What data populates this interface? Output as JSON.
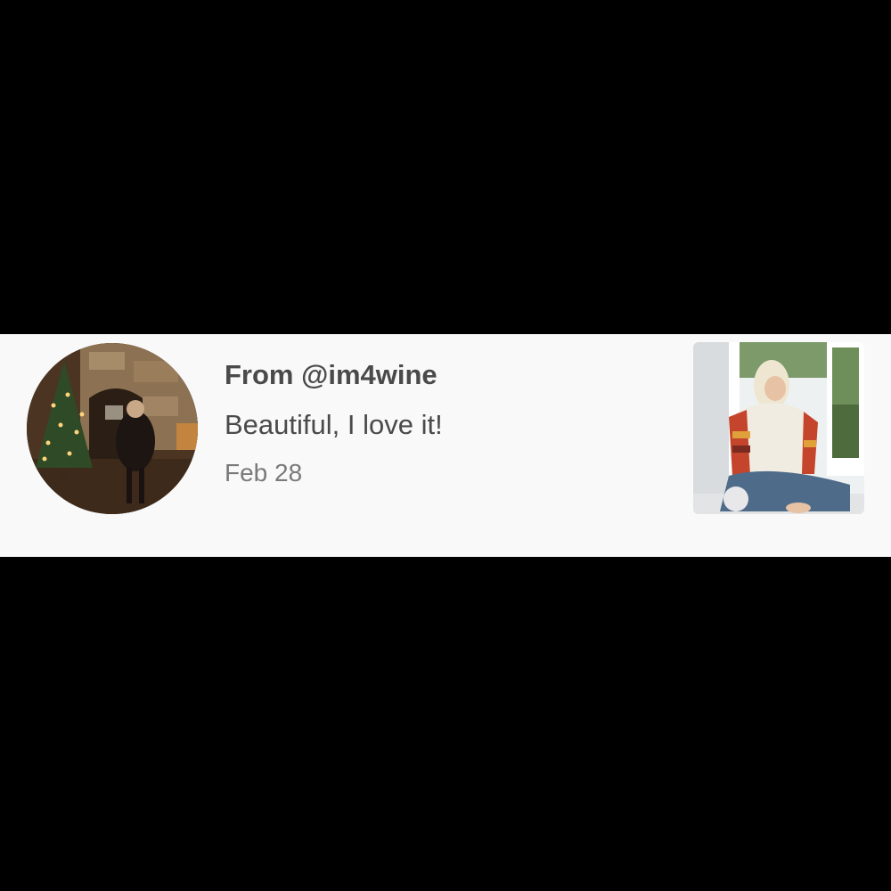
{
  "notification": {
    "sender_line": "From @im4wine",
    "message": "Beautiful, I love it!",
    "date": "Feb 28",
    "avatar_icon": "user-avatar-photo",
    "thumbnail_icon": "post-thumbnail-photo"
  },
  "colors": {
    "row_background": "#f9f9f9",
    "backdrop": "#000000",
    "primary_text": "#4a4a4a",
    "secondary_text": "#7a7a7a"
  }
}
